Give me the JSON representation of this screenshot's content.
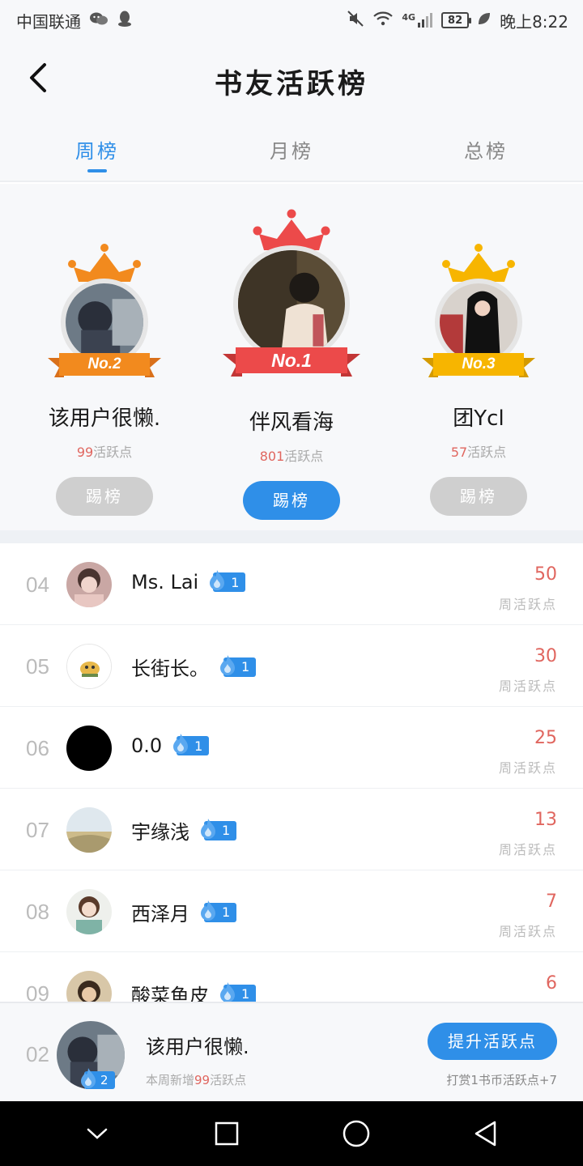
{
  "status_bar": {
    "carrier": "中国联通",
    "network": "4G",
    "battery": "82",
    "time": "晚上8:22"
  },
  "header": {
    "title": "书友活跃榜"
  },
  "tabs": [
    {
      "label": "周榜",
      "active": true
    },
    {
      "label": "月榜",
      "active": false
    },
    {
      "label": "总榜",
      "active": false
    }
  ],
  "podium": {
    "first": {
      "rank_label": "No.1",
      "name": "伴风看海",
      "points": "801",
      "points_suffix": "活跃点",
      "button": "踢榜"
    },
    "second": {
      "rank_label": "No.2",
      "name": "该用户很懒.",
      "points": "99",
      "points_suffix": "活跃点",
      "button": "踢榜"
    },
    "third": {
      "rank_label": "No.3",
      "name": "团Ycl",
      "points": "57",
      "points_suffix": "活跃点",
      "button": "踢榜"
    }
  },
  "list": {
    "score_label": "周活跃点",
    "rows": [
      {
        "rank": "04",
        "name": "Ms. Lai",
        "badge": "1",
        "score": "50"
      },
      {
        "rank": "05",
        "name": "长街长。",
        "badge": "1",
        "score": "30"
      },
      {
        "rank": "06",
        "name": "0.0",
        "badge": "1",
        "score": "25"
      },
      {
        "rank": "07",
        "name": "宇缘浅",
        "badge": "1",
        "score": "13"
      },
      {
        "rank": "08",
        "name": "西泽月",
        "badge": "1",
        "score": "7"
      },
      {
        "rank": "09",
        "name": "酸菜鱼皮",
        "badge": "1",
        "score": "6"
      }
    ]
  },
  "self": {
    "rank": "02",
    "name": "该用户很懒.",
    "badge": "2",
    "sub_prefix": "本周新增",
    "sub_points": "99",
    "sub_suffix": "活跃点",
    "boost_button": "提升活跃点",
    "boost_note": "打赏1书币活跃点+7"
  },
  "colors": {
    "accent": "#2f8fe8",
    "score_red": "#e0665f",
    "gold": "#f7b500",
    "silver_orange": "#f28a1e",
    "first_red": "#ec4a4a"
  }
}
